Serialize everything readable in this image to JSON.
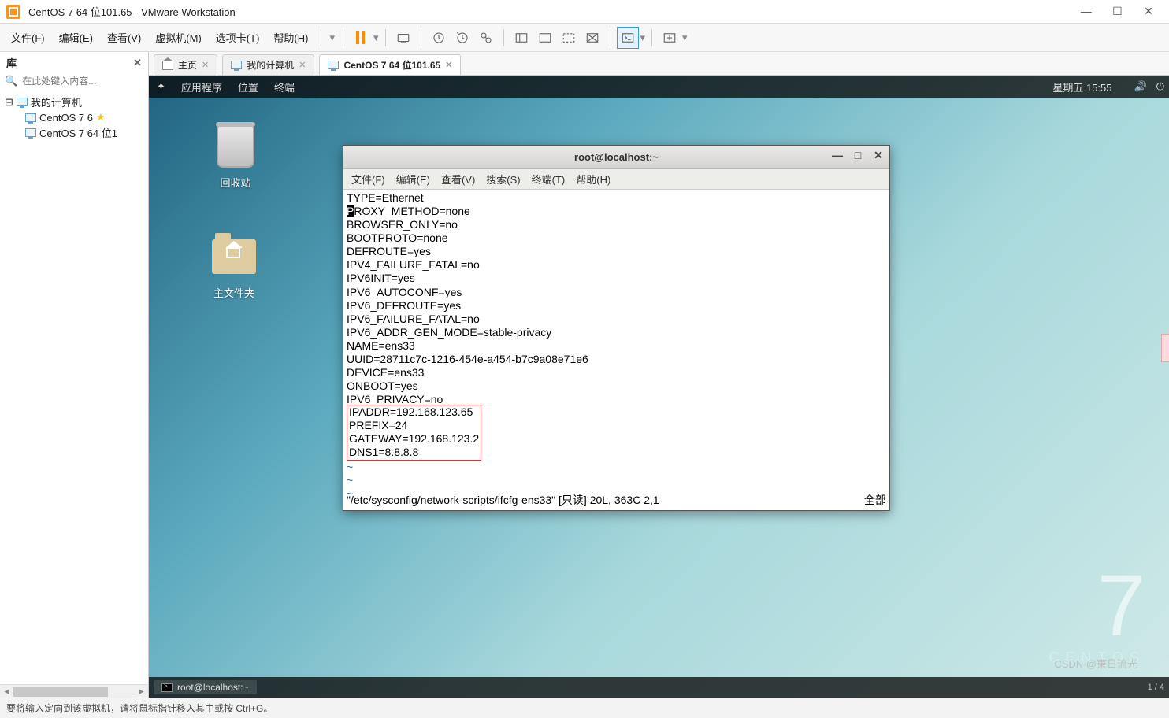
{
  "window": {
    "title": "CentOS 7 64 位101.65 - VMware Workstation"
  },
  "menubar": {
    "file": "文件(F)",
    "edit": "编辑(E)",
    "view": "查看(V)",
    "vm": "虚拟机(M)",
    "tabs": "选项卡(T)",
    "help": "帮助(H)"
  },
  "sidebar": {
    "title": "库",
    "search_placeholder": "在此处键入内容...",
    "tree": {
      "root": "我的计算机",
      "items": [
        "CentOS 7 6",
        "CentOS 7 64 位1"
      ]
    }
  },
  "tabs": {
    "home": "主页",
    "mycomputer": "我的计算机",
    "active": "CentOS 7 64 位101.65"
  },
  "gnome": {
    "apps": "应用程序",
    "places": "位置",
    "terminal": "终端",
    "clock": "星期五 15:55"
  },
  "desktop": {
    "trash": "回收站",
    "home": "主文件夹"
  },
  "brand": {
    "logo": "7",
    "name": "CENTOS"
  },
  "terminal": {
    "title": "root@localhost:~",
    "menu": {
      "file": "文件(F)",
      "edit": "编辑(E)",
      "view": "查看(V)",
      "search": "搜索(S)",
      "term": "终端(T)",
      "help": "帮助(H)"
    },
    "lines": [
      "TYPE=Ethernet",
      "PROXY_METHOD=none",
      "BROWSER_ONLY=no",
      "BOOTPROTO=none",
      "DEFROUTE=yes",
      "IPV4_FAILURE_FATAL=no",
      "IPV6INIT=yes",
      "IPV6_AUTOCONF=yes",
      "IPV6_DEFROUTE=yes",
      "IPV6_FAILURE_FATAL=no",
      "IPV6_ADDR_GEN_MODE=stable-privacy",
      "NAME=ens33",
      "UUID=28711c7c-1216-454e-a454-b7c9a08e71e6",
      "DEVICE=ens33",
      "ONBOOT=yes",
      "IPV6_PRIVACY=no"
    ],
    "box_lines": [
      "IPADDR=192.168.123.65",
      "PREFIX=24",
      "GATEWAY=192.168.123.2",
      "DNS1=8.8.8.8"
    ],
    "status_left": "\"/etc/sysconfig/network-scripts/ifcfg-ens33\" [只读] 20L, 363C 2,1",
    "status_right": "全部"
  },
  "guest_taskbar": {
    "item": "root@localhost:~",
    "pager": "1 / 4"
  },
  "statusbar": {
    "text": "要将输入定向到该虚拟机，请将鼠标指针移入其中或按 Ctrl+G。"
  },
  "watermark": "CSDN @東日流光"
}
